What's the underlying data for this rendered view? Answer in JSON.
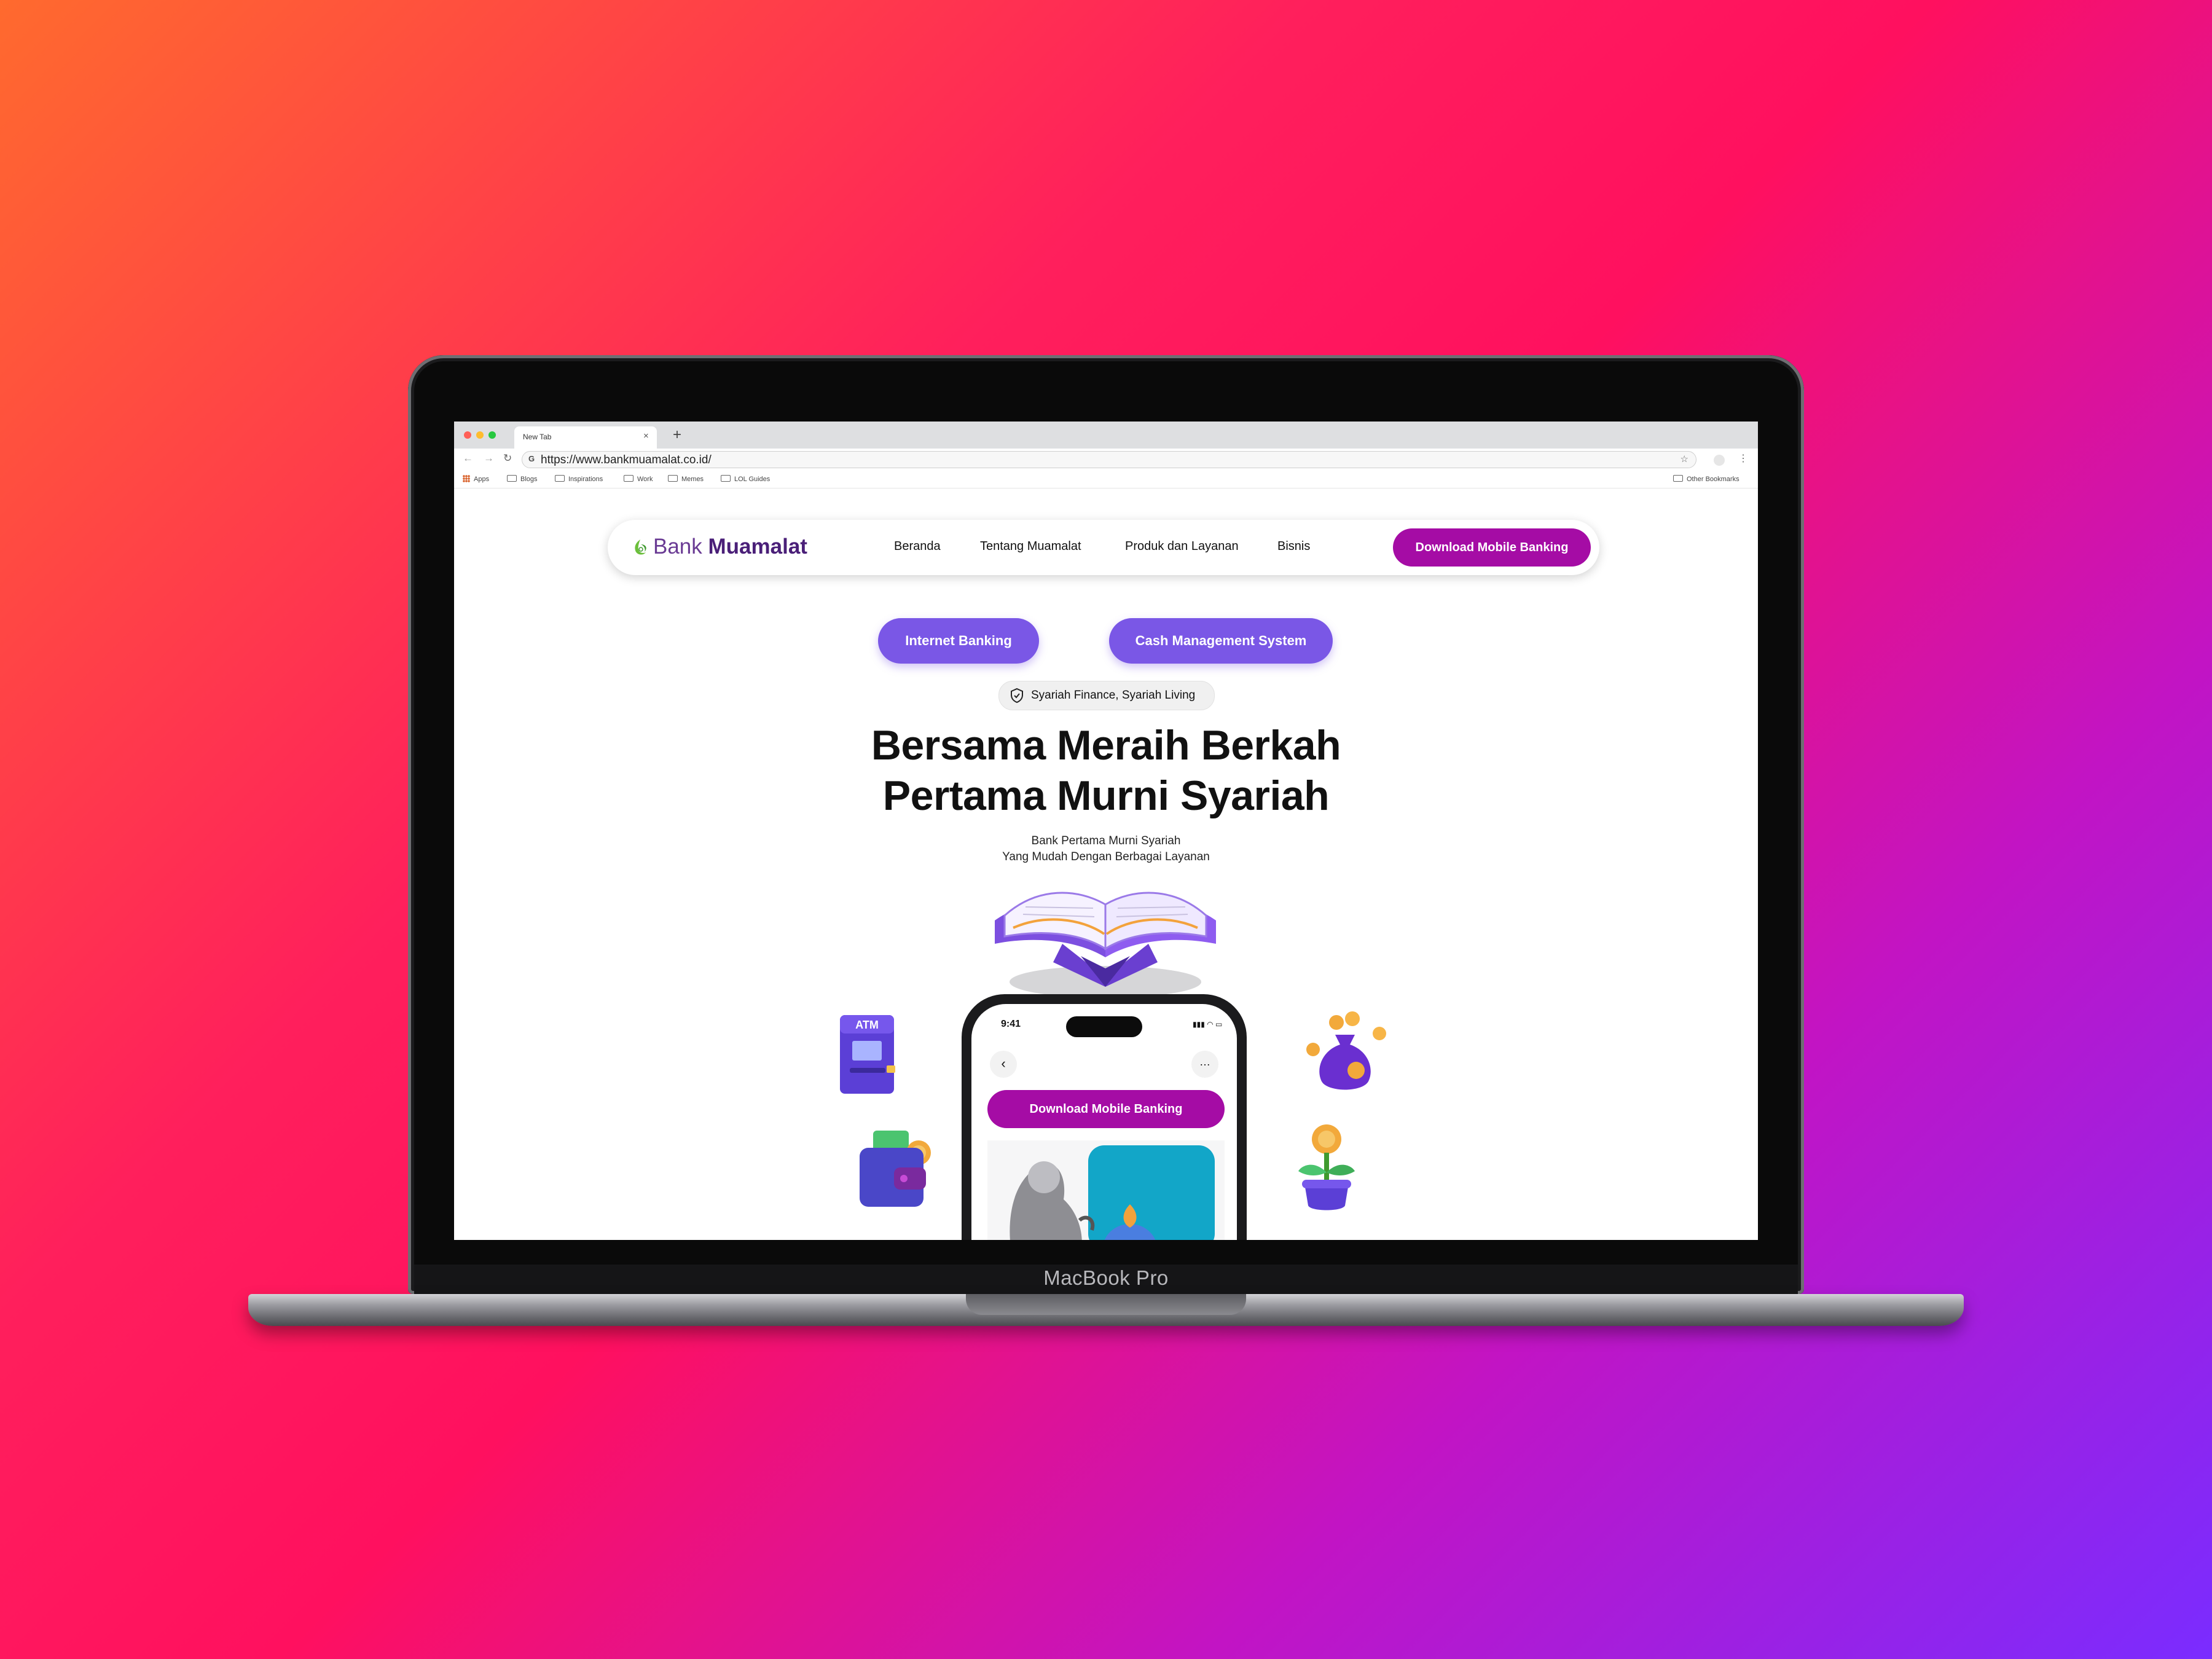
{
  "device": {
    "label": "MacBook Pro"
  },
  "browser": {
    "tab_title": "New Tab",
    "tab_close": "×",
    "new_tab": "+",
    "url": "https://www.bankmuamalat.co.id/",
    "bookmarks": [
      "Apps",
      "Blogs",
      "Inspirations",
      "Work",
      "Memes",
      "LOL Guides"
    ],
    "other_bookmarks": "Other Bookmarks"
  },
  "site": {
    "logo": {
      "word1": "Bank",
      "word2": "Muamalat"
    },
    "nav": [
      "Beranda",
      "Tentang Muamalat",
      "Produk dan Layanan",
      "Bisnis"
    ],
    "cta": "Download Mobile Banking",
    "quick_links": [
      "Internet Banking",
      "Cash Management System"
    ],
    "badge": "Syariah Finance, Syariah Living",
    "headline": [
      "Bersama Meraih Berkah",
      "Pertama Murni Syariah"
    ],
    "subtitle": [
      "Bank Pertama Murni Syariah",
      "Yang Mudah Dengan Berbagai Layanan"
    ],
    "illustrations": [
      "quran-stand-icon",
      "atm-icon",
      "wallet-icon",
      "money-bag-icon",
      "money-plant-icon"
    ]
  },
  "phone": {
    "time": "9:41",
    "cta": "Download Mobile Banking"
  },
  "colors": {
    "brand_magenta": "#a50ca5",
    "pill_purple": "#7a57e6",
    "logo_purple": "#4a1f78"
  }
}
